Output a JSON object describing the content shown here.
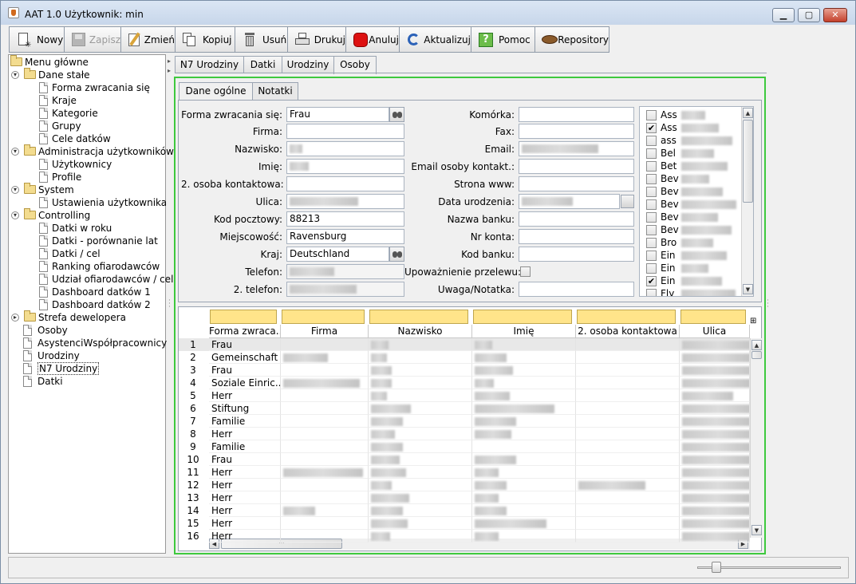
{
  "window": {
    "title": "AAT 1.0  Użytkownik: min"
  },
  "toolbar": {
    "buttons": [
      {
        "label": "Nowy",
        "icon": "new-document-icon",
        "enabled": true
      },
      {
        "label": "Zapisz",
        "icon": "save-disk-icon",
        "enabled": false
      },
      {
        "label": "Zmień",
        "icon": "edit-pencil-icon",
        "enabled": true
      },
      {
        "label": "Kopiuj",
        "icon": "copy-icon",
        "enabled": true
      },
      {
        "label": "Usuń",
        "icon": "trash-icon",
        "enabled": true
      },
      {
        "label": "Drukuj",
        "icon": "printer-icon",
        "enabled": true
      },
      {
        "label": "Anuluj",
        "icon": "stop-icon",
        "enabled": true
      },
      {
        "label": "Aktualizuj",
        "icon": "refresh-icon",
        "enabled": true
      },
      {
        "label": "Pomoc",
        "icon": "help-icon",
        "enabled": true
      },
      {
        "label": "Repository",
        "icon": "repository-icon",
        "enabled": true
      }
    ]
  },
  "tree": {
    "root": "Menu główne",
    "nodes": [
      {
        "label": "Dane stałe",
        "type": "folder",
        "level": 1,
        "expanded": true
      },
      {
        "label": "Forma zwracania się",
        "type": "doc",
        "level": 2
      },
      {
        "label": "Kraje",
        "type": "doc",
        "level": 2
      },
      {
        "label": "Kategorie",
        "type": "doc",
        "level": 2
      },
      {
        "label": "Grupy",
        "type": "doc",
        "level": 2
      },
      {
        "label": "Cele datków",
        "type": "doc",
        "level": 2
      },
      {
        "label": "Administracja użytkowników",
        "type": "folder",
        "level": 1,
        "expanded": true
      },
      {
        "label": "Użytkownicy",
        "type": "doc",
        "level": 2
      },
      {
        "label": "Profile",
        "type": "doc",
        "level": 2
      },
      {
        "label": "System",
        "type": "folder",
        "level": 1,
        "expanded": true
      },
      {
        "label": "Ustawienia użytkownika",
        "type": "doc",
        "level": 2
      },
      {
        "label": "Controlling",
        "type": "folder",
        "level": 1,
        "expanded": true
      },
      {
        "label": "Datki w roku",
        "type": "doc",
        "level": 2
      },
      {
        "label": "Datki - porównanie lat",
        "type": "doc",
        "level": 2
      },
      {
        "label": "Datki / cel",
        "type": "doc",
        "level": 2
      },
      {
        "label": "Ranking ofiarodawców",
        "type": "doc",
        "level": 2
      },
      {
        "label": "Udział ofiarodawców / cel",
        "type": "doc",
        "level": 2
      },
      {
        "label": "Dashboard datków 1",
        "type": "doc",
        "level": 2
      },
      {
        "label": "Dashboard datków 2",
        "type": "doc",
        "level": 2
      },
      {
        "label": "Strefa dewelopera",
        "type": "folder",
        "level": 1,
        "expanded": false
      },
      {
        "label": "Osoby",
        "type": "doc",
        "level": 1
      },
      {
        "label": "AsystenciWspółpracownicy",
        "type": "doc",
        "level": 1
      },
      {
        "label": "Urodziny",
        "type": "doc",
        "level": 1
      },
      {
        "label": "N7 Urodziny",
        "type": "doc",
        "level": 1,
        "selected": true
      },
      {
        "label": "Datki",
        "type": "doc",
        "level": 1
      }
    ]
  },
  "tabs": [
    "N7 Urodziny",
    "Datki",
    "Urodziny",
    "Osoby"
  ],
  "active_tab": "Osoby",
  "inner_tabs": [
    "Dane ogólne",
    "Notatki"
  ],
  "form": {
    "left": [
      {
        "label": "Forma zwracania się:",
        "value": "Frau",
        "lookup": true
      },
      {
        "label": "Firma:",
        "value": ""
      },
      {
        "label": "Nazwisko:",
        "value": "",
        "redacted": 16
      },
      {
        "label": "Imię:",
        "value": "",
        "redacted": 24
      },
      {
        "label": "2. osoba kontaktowa:",
        "value": ""
      },
      {
        "label": "Ulica:",
        "value": "",
        "redacted": 86
      },
      {
        "label": "Kod pocztowy:",
        "value": "88213"
      },
      {
        "label": "Miejscowość:",
        "value": "Ravensburg"
      },
      {
        "label": "Kraj:",
        "value": "Deutschland",
        "lookup": true
      },
      {
        "label": "Telefon:",
        "value": "",
        "redacted": 56,
        "readonly": true
      },
      {
        "label": "2. telefon:",
        "value": "",
        "redacted": 84,
        "readonly": true
      }
    ],
    "right": [
      {
        "label": "Komórka:",
        "value": ""
      },
      {
        "label": "Fax:",
        "value": ""
      },
      {
        "label": "Email:",
        "value": "",
        "redacted": 96
      },
      {
        "label": "Email osoby kontakt.:",
        "value": ""
      },
      {
        "label": "Strona www:",
        "value": ""
      },
      {
        "label": "Data urodzenia:",
        "value": "",
        "redacted": 64,
        "calendar": true
      },
      {
        "label": "Nazwa banku:",
        "value": ""
      },
      {
        "label": "Nr konta:",
        "value": ""
      },
      {
        "label": "Kod banku:",
        "value": ""
      },
      {
        "label": "Upoważnienie przelewu:",
        "checkbox": true,
        "checked": false
      },
      {
        "label": "Uwaga/Notatka:",
        "value": ""
      }
    ]
  },
  "categories": [
    {
      "label": "Ass",
      "checked": false
    },
    {
      "label": "Ass",
      "checked": true
    },
    {
      "label": "ass",
      "checked": false
    },
    {
      "label": "Bel",
      "checked": false
    },
    {
      "label": "Bet",
      "checked": false
    },
    {
      "label": "Bev",
      "checked": false
    },
    {
      "label": "Bev",
      "checked": false
    },
    {
      "label": "Bev",
      "checked": false
    },
    {
      "label": "Bev",
      "checked": false
    },
    {
      "label": "Bev",
      "checked": false
    },
    {
      "label": "Bro",
      "checked": false
    },
    {
      "label": "Ein",
      "checked": false
    },
    {
      "label": "Ein",
      "checked": false
    },
    {
      "label": "Ein",
      "checked": true
    },
    {
      "label": "Fly",
      "checked": false
    }
  ],
  "table": {
    "columns": [
      "Forma zwraca...",
      "Firma",
      "Nazwisko",
      "Imię",
      "2. osoba kontaktowa",
      "Ulica"
    ],
    "rows": [
      {
        "n": "1",
        "forma": "Frau",
        "firma": 0,
        "nazwisko": 22,
        "imie": 22,
        "kontakt": 0,
        "ulica": 90
      },
      {
        "n": "2",
        "forma": "Gemeinschaft",
        "firma": 56,
        "nazwisko": 20,
        "imie": 40,
        "kontakt": 0,
        "ulica": 86
      },
      {
        "n": "3",
        "forma": "Frau",
        "firma": 0,
        "nazwisko": 26,
        "imie": 48,
        "kontakt": 0,
        "ulica": 90
      },
      {
        "n": "4",
        "forma": "Soziale Einric...",
        "firma": 96,
        "nazwisko": 26,
        "imie": 24,
        "kontakt": 0,
        "ulica": 86
      },
      {
        "n": "5",
        "forma": "Herr",
        "firma": 0,
        "nazwisko": 20,
        "imie": 44,
        "kontakt": 0,
        "ulica": 64
      },
      {
        "n": "6",
        "forma": "Stiftung",
        "firma": 0,
        "nazwisko": 50,
        "imie": 100,
        "kontakt": 0,
        "ulica": 90
      },
      {
        "n": "7",
        "forma": "Familie",
        "firma": 0,
        "nazwisko": 40,
        "imie": 52,
        "kontakt": 0,
        "ulica": 86
      },
      {
        "n": "8",
        "forma": "Herr",
        "firma": 0,
        "nazwisko": 30,
        "imie": 46,
        "kontakt": 0,
        "ulica": 90
      },
      {
        "n": "9",
        "forma": "Familie",
        "firma": 0,
        "nazwisko": 40,
        "imie": 0,
        "kontakt": 0,
        "ulica": 86
      },
      {
        "n": "10",
        "forma": "Frau",
        "firma": 0,
        "nazwisko": 36,
        "imie": 52,
        "kontakt": 0,
        "ulica": 86
      },
      {
        "n": "11",
        "forma": "Herr",
        "firma": 100,
        "nazwisko": 44,
        "imie": 30,
        "kontakt": 0,
        "ulica": 90
      },
      {
        "n": "12",
        "forma": "Herr",
        "firma": 0,
        "nazwisko": 26,
        "imie": 40,
        "kontakt": 84,
        "ulica": 90
      },
      {
        "n": "13",
        "forma": "Herr",
        "firma": 0,
        "nazwisko": 48,
        "imie": 30,
        "kontakt": 0,
        "ulica": 86
      },
      {
        "n": "14",
        "forma": "Herr",
        "firma": 40,
        "nazwisko": 40,
        "imie": 40,
        "kontakt": 0,
        "ulica": 90
      },
      {
        "n": "15",
        "forma": "Herr",
        "firma": 0,
        "nazwisko": 46,
        "imie": 90,
        "kontakt": 0,
        "ulica": 86
      },
      {
        "n": "16",
        "forma": "Herr",
        "firma": 0,
        "nazwisko": 24,
        "imie": 30,
        "kontakt": 0,
        "ulica": 86
      }
    ]
  }
}
